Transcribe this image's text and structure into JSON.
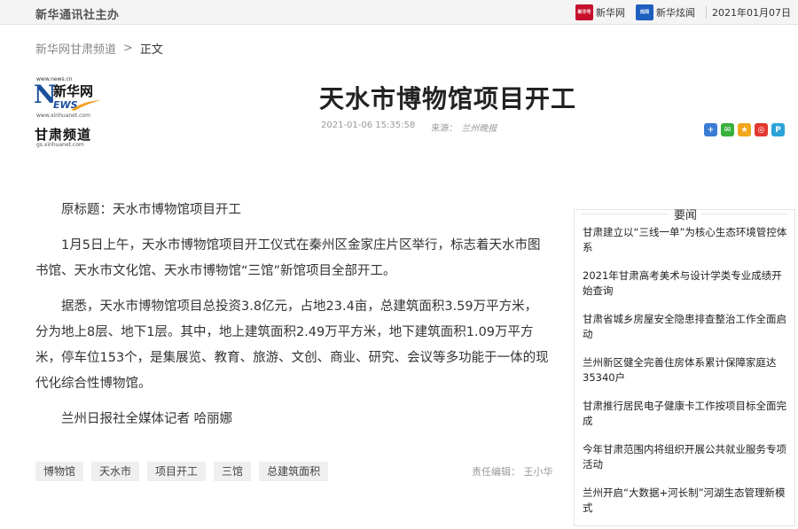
{
  "topbar": {
    "brand": "新华通讯社主办",
    "apps": [
      {
        "icon": "xinhua-app-icon",
        "icon_text": "新华号",
        "label": "新华网"
      },
      {
        "icon": "xinhua-show-icon",
        "icon_text": "炫闻",
        "label": "新华炫闻"
      }
    ],
    "date": "2021年01月07日"
  },
  "breadcrumb": {
    "home": "新华网甘肃频道",
    "separator": ">",
    "current": "正文"
  },
  "logo": {
    "site": "www.news.cn",
    "n": "N",
    "name": "新华网",
    "ews": "EWS",
    "url1": "www.xinhuanet.com",
    "channel": "甘肃频道",
    "url2": "gs.xinhuanet.com"
  },
  "article": {
    "title": "天水市博物馆项目开工",
    "datetime": "2021-01-06 15:35:58",
    "source_label": "来源：",
    "source": "兰州晚报",
    "paragraphs": [
      "原标题：天水市博物馆项目开工",
      "1月5日上午，天水市博物馆项目开工仪式在秦州区金家庄片区举行，标志着天水市图书馆、天水市文化馆、天水市博物馆“三馆”新馆项目全部开工。",
      "据悉，天水市博物馆项目总投资3.8亿元，占地23.4亩，总建筑面积3.59万平方米，分为地上8层、地下1层。其中，地上建筑面积2.49万平方米，地下建筑面积1.09万平方米，停车位153个，是集展览、教育、旅游、文创、商业、研究、会议等多功能于一体的现代化综合性博物馆。",
      "兰州日报社全媒体记者 哈丽娜"
    ],
    "tags": [
      "博物馆",
      "天水市",
      "项目开工",
      "三馆",
      "总建筑面积"
    ],
    "editor": "责任编辑：  王小华"
  },
  "share": [
    "share-plus-icon",
    "wechat-icon",
    "qzone-icon",
    "weibo-icon",
    "share-p-icon"
  ],
  "share_glyphs": [
    "+",
    "✉",
    "★",
    "◎",
    "P"
  ],
  "sidebar": {
    "title": "要闻",
    "items": [
      "甘肃建立以“三线一单”为核心生态环境管控体系",
      "2021年甘肃高考美术与设计学类专业成绩开始查询",
      "甘肃省城乡房屋安全隐患排查整治工作全面启动",
      "兰州新区健全完善住房体系累计保障家庭达35340户",
      "甘肃推行居民电子健康卡工作按项目标全面完成",
      "今年甘肃范围内将组织开展公共就业服务专项活动",
      "兰州开启“大数据+河长制”河湖生态管理新模式"
    ]
  },
  "colors": {
    "brand_blue": "#1c4f9c",
    "text": "#333333",
    "muted": "#999999"
  }
}
